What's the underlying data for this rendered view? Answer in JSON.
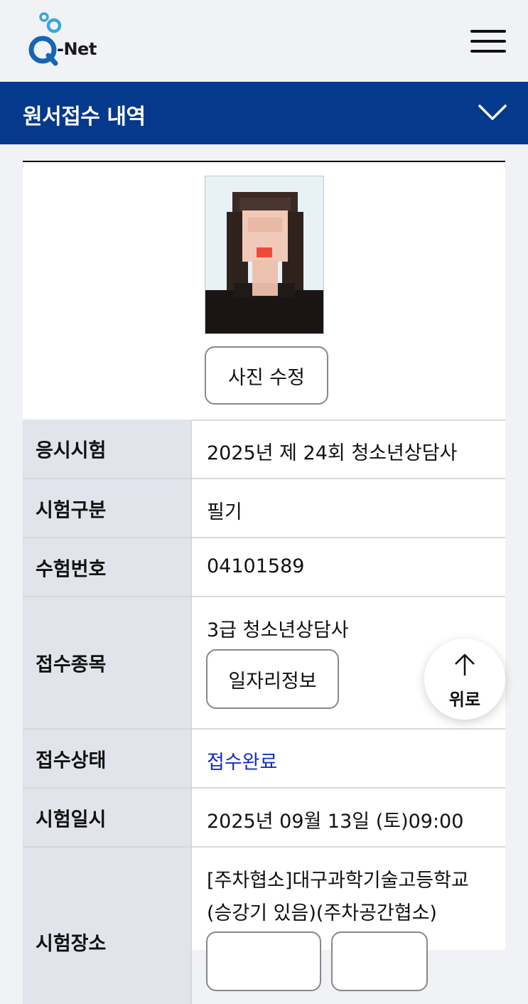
{
  "header": {
    "logo_text": "-Net",
    "logo_letter": "Q",
    "menu_icon": "hamburger-menu-icon"
  },
  "titlebar": {
    "title": "원서접수 내역",
    "expand_icon": "chevron-down-icon"
  },
  "photo": {
    "edit_button": "사진 수정"
  },
  "rows": {
    "exam": {
      "label": "응시시험",
      "value": "2025년 제 24회 청소년상담사"
    },
    "type": {
      "label": "시험구분",
      "value": "필기"
    },
    "number": {
      "label": "수험번호",
      "value": "04101589"
    },
    "subject": {
      "label": "접수종목",
      "value": "3급 청소년상담사",
      "button": "일자리정보"
    },
    "status": {
      "label": "접수상태",
      "value": "접수완료"
    },
    "datetime": {
      "label": "시험일시",
      "value": "2025년 09월 13일 (토)09:00"
    },
    "location": {
      "label": "시험장소",
      "value_line1": "[주차협소]대구과학기술고등학교",
      "value_line2": "(승강기 있음)(주차공간협소)"
    }
  },
  "scroll_top": {
    "label": "위로",
    "icon": "arrow-up-icon"
  },
  "colors": {
    "brand_blue": "#04398c",
    "status_blue": "#1030c8",
    "label_bg": "#e1e4eb"
  }
}
